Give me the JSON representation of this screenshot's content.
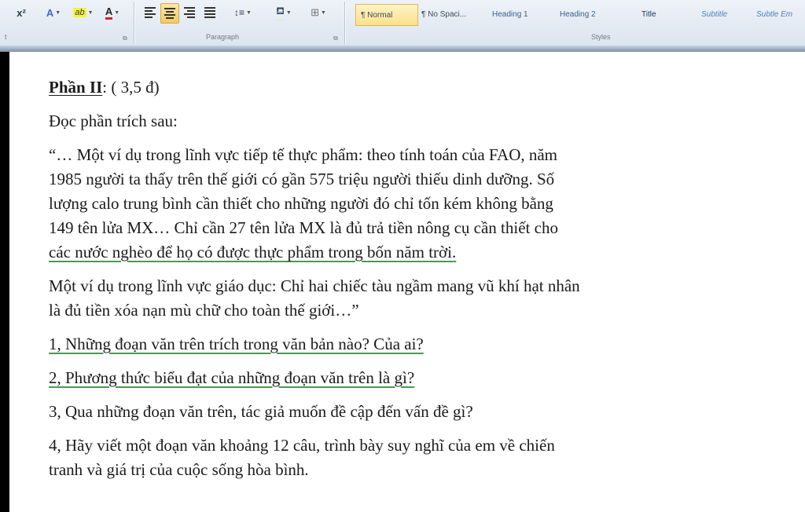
{
  "ribbon": {
    "font_group": {
      "clear_format_label": "x²",
      "highlight_label": "ab",
      "font_color_label": "A"
    },
    "paragraph_group": {
      "label": "Paragraph",
      "left_partial_label": "t"
    },
    "styles_group": {
      "label": "Styles",
      "items": [
        {
          "label": "¶ Normal"
        },
        {
          "label": "¶ No Spaci..."
        },
        {
          "label": "Heading 1"
        },
        {
          "label": "Heading 2"
        },
        {
          "label": "Title"
        },
        {
          "label": "Subtitle"
        },
        {
          "label": "Subtle Em"
        }
      ]
    }
  },
  "document": {
    "heading_title": "Phần II",
    "heading_score": ": ( 3,5 đ)",
    "intro": "Đọc phần trích sau:",
    "quote_lines": [
      "“… Một ví dụ trong lĩnh vực tiếp tế thực phẩm: theo tính toán của FAO, năm",
      "1985 người ta thấy trên thế giới có gần 575 triệu người thiếu dinh dưỡng. Số",
      "lượng calo trung bình cần thiết cho những người đó chỉ tốn kém không bằng",
      "149 tên lửa MX… Chỉ cần 27 tên lửa MX là đủ trả tiền nông cụ cần thiết cho",
      "các nước nghèo để họ có được thực phẩm trong bốn năm trời."
    ],
    "quote2_lines": [
      "Một ví dụ trong lĩnh vực giáo dục: Chỉ hai chiếc tàu ngầm mang vũ khí hạt nhân",
      "là đủ tiền xóa nạn mù chữ cho toàn thế giới…”"
    ],
    "questions": [
      "1, Những đoạn văn trên trích trong văn bản nào? Của ai?",
      "2, Phương thức biểu đạt của những đoạn văn trên là gì?",
      "3, Qua những đoạn văn trên, tác giả muốn đề cập đến vấn đề gì?"
    ],
    "question4_lines": [
      "4, Hãy viết một đoạn văn khoảng 12 câu, trình bày suy nghĩ của em về chiến",
      "tranh và giá trị của cuộc sống hòa bình."
    ]
  }
}
